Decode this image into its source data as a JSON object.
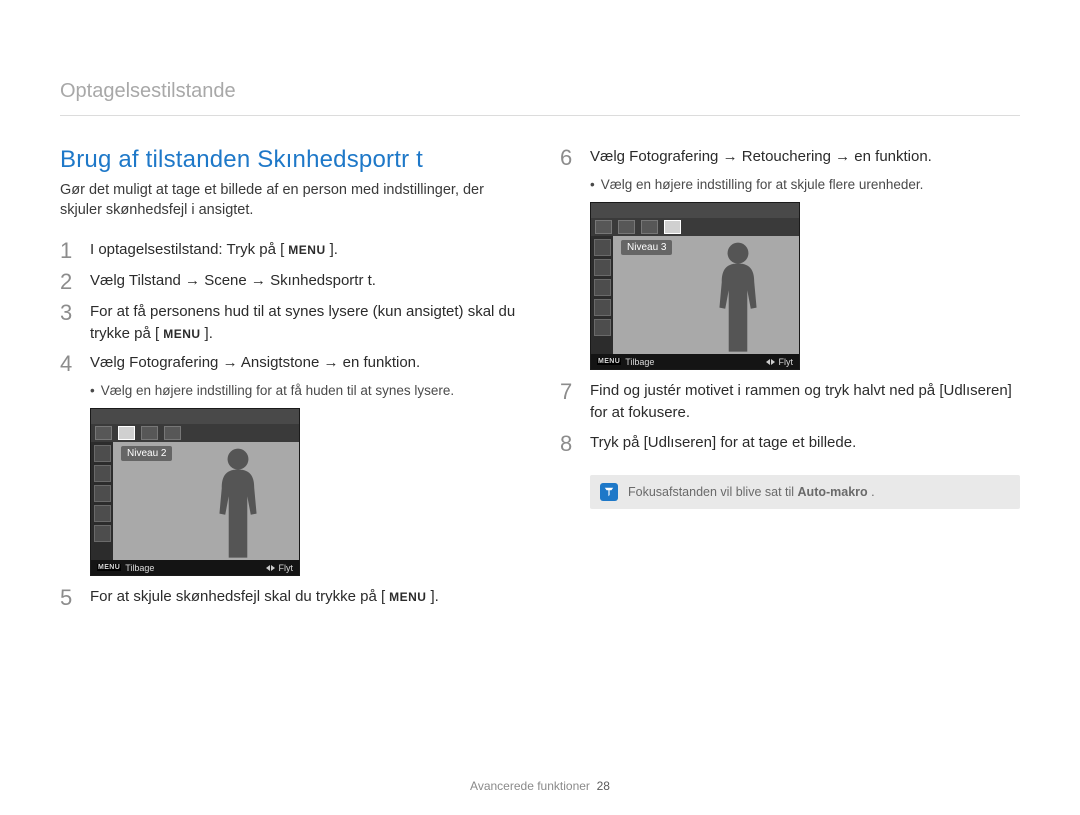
{
  "breadcrumb": "Optagelsestilstande",
  "section": {
    "title": "Brug af tilstanden Skınhedsportr t",
    "description": "Gør det muligt at tage et billede af en person med indstillinger, der skjuler skønhedsfejl i ansigtet."
  },
  "menu_chip": "MENU",
  "steps_left": {
    "s1": {
      "num": "1",
      "pre": "I optagelsestilstand: Tryk på [",
      "post": "]."
    },
    "s2": {
      "num": "2",
      "text": "Vælg Tilstand → Scene → Skınhedsportr t."
    },
    "s3": {
      "num": "3",
      "pre": "For at få personens hud til at synes lysere (kun ansigtet) skal du trykke på [",
      "post": "]."
    },
    "s4": {
      "num": "4",
      "text": "Vælg Fotografering → Ansigtstone → en funktion.",
      "bullet": "Vælg en højere indstilling for at få huden til at synes lysere."
    },
    "s5": {
      "num": "5",
      "pre": "For at skjule skønhedsfejl skal du trykke på [",
      "post": "]."
    }
  },
  "steps_right": {
    "s6": {
      "num": "6",
      "text": "Vælg Fotografering → Retouchering → en funktion.",
      "bullet": "Vælg en højere indstilling for at skjule flere urenheder."
    },
    "s7": {
      "num": "7",
      "text": "Find og justér motivet i rammen og tryk halvt ned på [Udlıseren] for at fokusere."
    },
    "s8": {
      "num": "8",
      "text": "Tryk på [Udlıseren] for at tage et billede."
    }
  },
  "camera1": {
    "level": "Niveau 2",
    "back": "Tilbage",
    "move": "Flyt",
    "menu": "MENU"
  },
  "camera2": {
    "level": "Niveau 3",
    "back": "Tilbage",
    "move": "Flyt",
    "menu": "MENU"
  },
  "note": {
    "text_pre": "Fokusafstanden vil blive sat til ",
    "bold": "Auto-makro",
    "text_post": " ."
  },
  "footer": {
    "label": "Avancerede funktioner",
    "page": "28"
  }
}
